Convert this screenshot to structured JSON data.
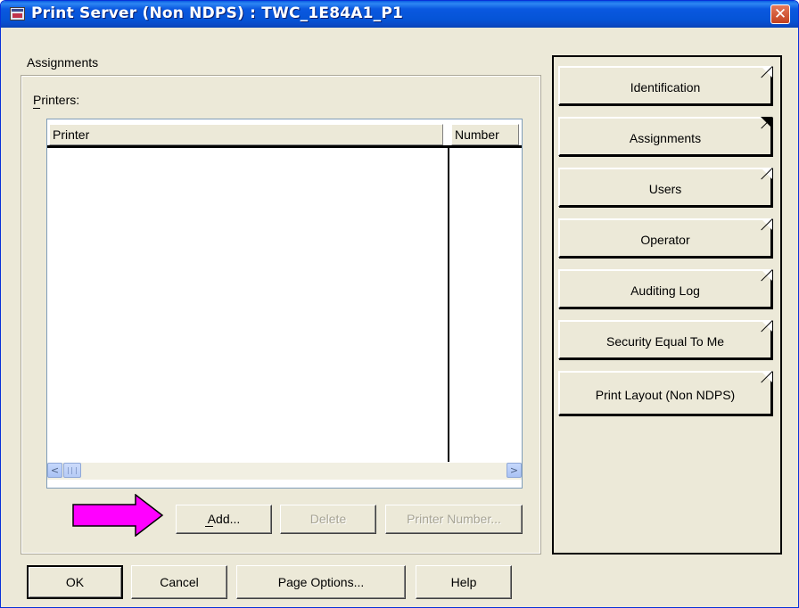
{
  "window": {
    "title": "Print Server (Non NDPS) : TWC_1E84A1_P1",
    "close_glyph": "✕",
    "accent": "#0a58e0",
    "icon": "app-window-icon"
  },
  "section": {
    "title": "Assignments",
    "printers_label": "Printers:"
  },
  "table": {
    "columns": [
      "Printer",
      "Number"
    ],
    "rows": []
  },
  "scrollbar": {
    "left": "<",
    "right": ">"
  },
  "actions": {
    "add": "Add...",
    "delete": "Delete",
    "printer_number": "Printer Number..."
  },
  "dialog_buttons": {
    "ok": "OK",
    "cancel": "Cancel",
    "page_options": "Page Options...",
    "help": "Help"
  },
  "tabs": [
    {
      "label": "Identification",
      "active": false
    },
    {
      "label": "Assignments",
      "active": true
    },
    {
      "label": "Users",
      "active": false
    },
    {
      "label": "Operator",
      "active": false
    },
    {
      "label": "Auditing Log",
      "active": false
    },
    {
      "label": "Security Equal To Me",
      "active": false
    },
    {
      "label": "Print Layout (Non NDPS)",
      "active": false
    }
  ],
  "annotation": {
    "arrow_color": "#ff00ff",
    "icon": "pointer-arrow-icon"
  }
}
